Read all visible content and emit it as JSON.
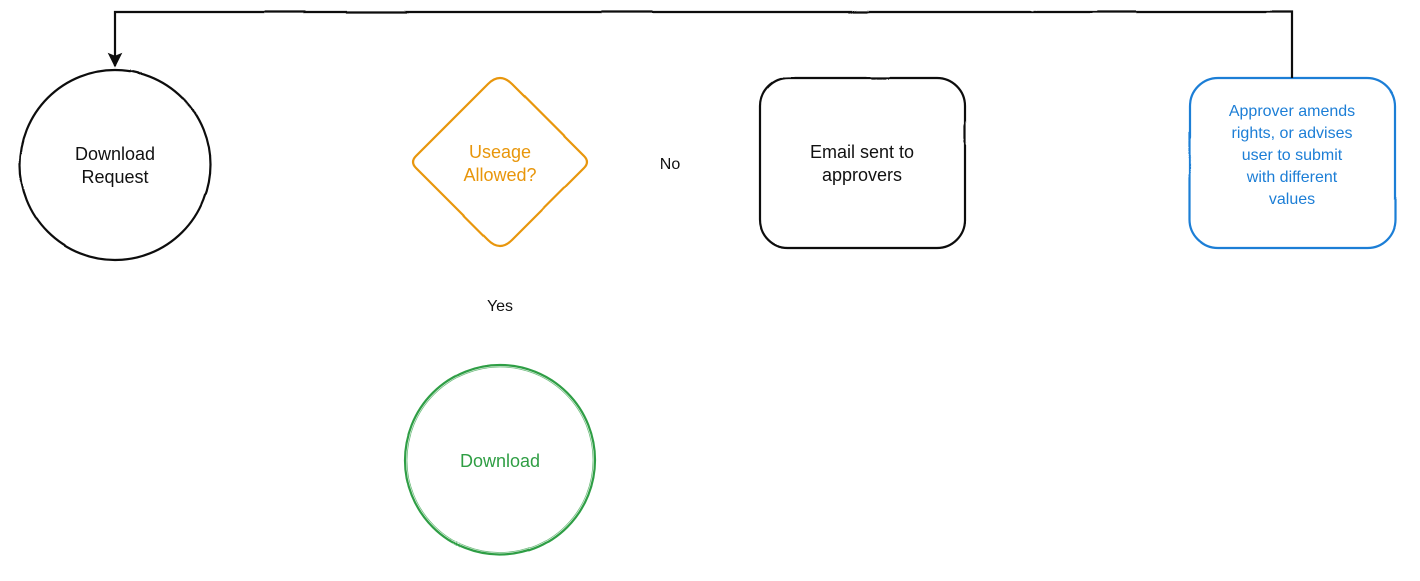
{
  "diagram": {
    "type": "flowchart",
    "nodes": {
      "request": {
        "shape": "circle",
        "lines": [
          "Download",
          "Request"
        ],
        "color": "#111111"
      },
      "decision": {
        "shape": "diamond",
        "lines": [
          "Useage",
          "Allowed?"
        ],
        "color": "#e8960b"
      },
      "download": {
        "shape": "circle",
        "lines": [
          "Download"
        ],
        "color": "#2f9e44"
      },
      "email": {
        "shape": "rounded-rect",
        "lines": [
          "Email sent to",
          "approvers"
        ],
        "color": "#111111"
      },
      "approver": {
        "shape": "rounded-rect",
        "lines": [
          "Approver amends",
          "rights, or advises",
          "user to submit",
          "with different",
          "values"
        ],
        "color": "#1c7ed6"
      }
    },
    "edges": {
      "request_to_decision": {
        "from": "request",
        "to": "decision",
        "label": ""
      },
      "decision_no": {
        "from": "decision",
        "to": "email",
        "label": "No"
      },
      "decision_yes": {
        "from": "decision",
        "to": "download",
        "label": "Yes"
      },
      "email_to_approver": {
        "from": "email",
        "to": "approver",
        "label": ""
      },
      "approver_to_request": {
        "from": "approver",
        "to": "request",
        "label": ""
      }
    }
  }
}
